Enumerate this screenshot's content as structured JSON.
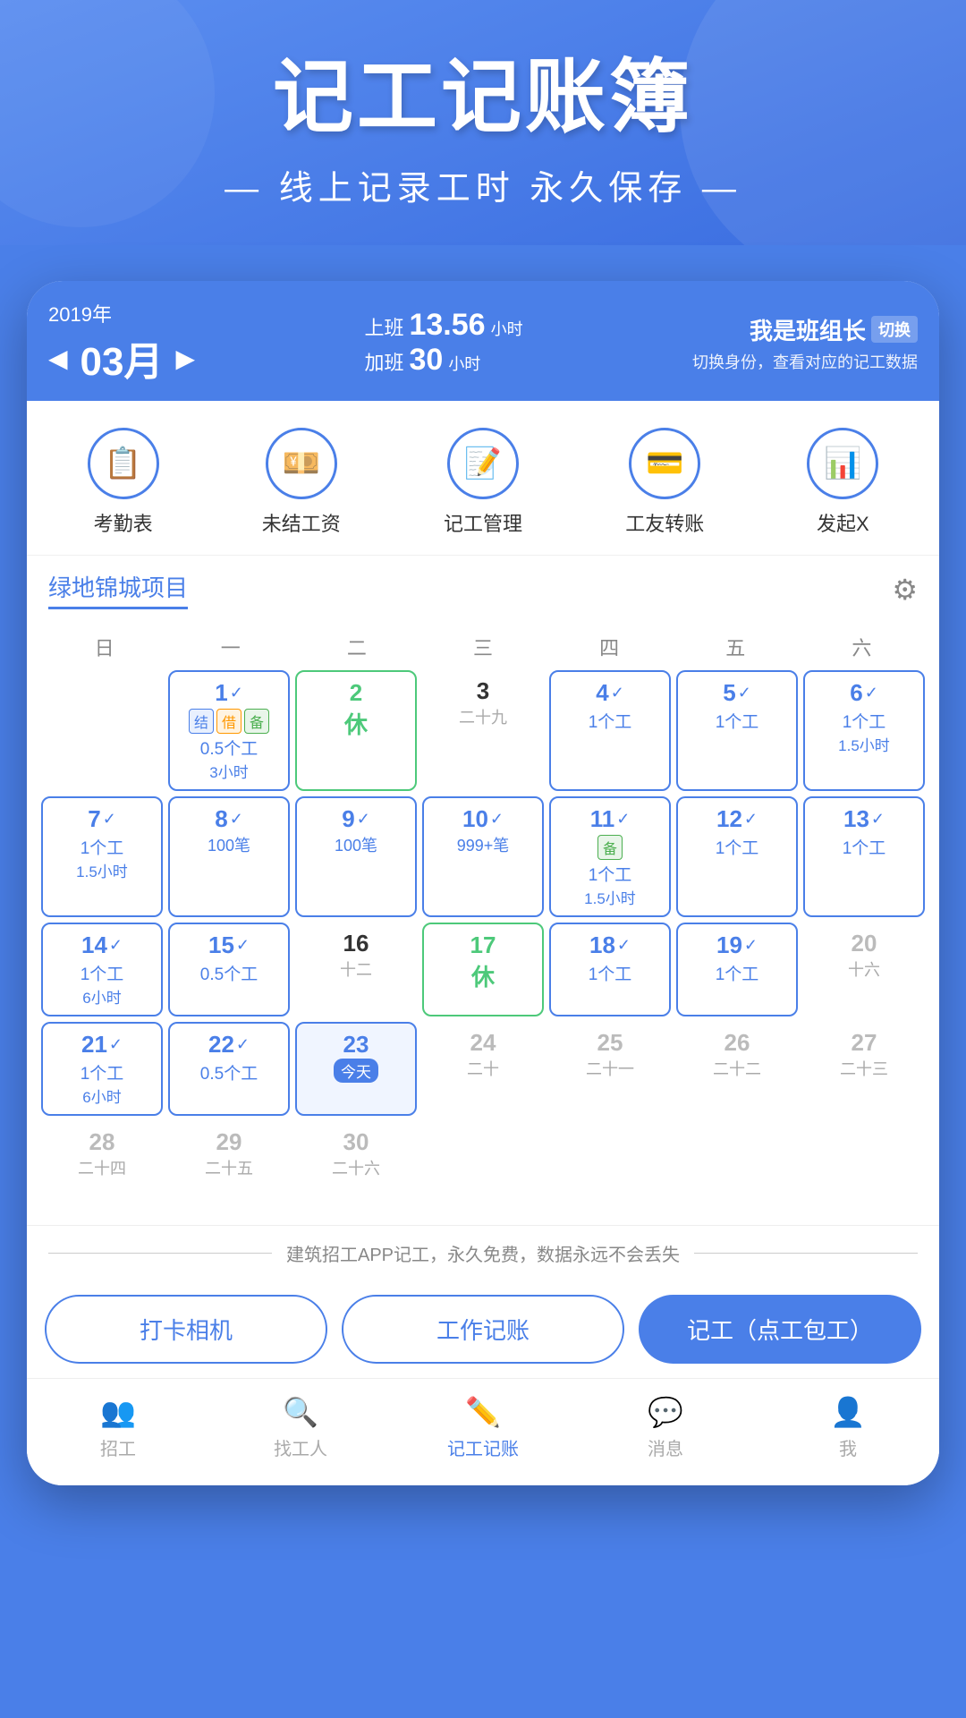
{
  "hero": {
    "title": "记工记账簿",
    "subtitle": "— 线上记录工时 永久保存 —"
  },
  "app_header": {
    "year": "2019年",
    "month": "03月",
    "prev_arrow": "◀",
    "next_arrow": "▶",
    "work_label": "上班",
    "work_hours": "13.56",
    "work_unit": "小时",
    "overtime_label": "加班",
    "overtime_hours": "30",
    "overtime_unit": "小时",
    "identity": "我是班组长",
    "switch_label": "切换",
    "identity_sub": "切换身份，查看对应的记工数据"
  },
  "functions": [
    {
      "icon": "📋",
      "label": "考勤表"
    },
    {
      "icon": "💴",
      "label": "未结工资"
    },
    {
      "icon": "📝",
      "label": "记工管理"
    },
    {
      "icon": "💳",
      "label": "工友转账"
    },
    {
      "icon": "📊",
      "label": "发起X"
    }
  ],
  "project": {
    "name": "绿地锦城项目",
    "settings_icon": "⚙"
  },
  "calendar": {
    "week_headers": [
      "日",
      "一",
      "二",
      "三",
      "四",
      "五",
      "六"
    ],
    "cells": [
      {
        "day": "",
        "type": "empty"
      },
      {
        "day": "1",
        "type": "data",
        "check": true,
        "tags": [
          "结",
          "借",
          "备"
        ],
        "work": "0.5个工",
        "hours": "3小时",
        "lunar": ""
      },
      {
        "day": "2",
        "type": "rest",
        "lunar": "",
        "rest": "休"
      },
      {
        "day": "3",
        "type": "plain",
        "lunar": "二十九"
      },
      {
        "day": "4",
        "type": "data",
        "check": true,
        "work": "1个工",
        "lunar": ""
      },
      {
        "day": "5",
        "type": "data",
        "check": true,
        "work": "1个工",
        "lunar": ""
      },
      {
        "day": "6",
        "type": "data",
        "check": true,
        "work": "1个工",
        "hours": "1.5小时",
        "lunar": ""
      },
      {
        "day": "7",
        "type": "data",
        "check": true,
        "work": "1个工",
        "hours": "1.5小时",
        "lunar": ""
      },
      {
        "day": "8",
        "type": "data",
        "check": true,
        "note": "100笔",
        "lunar": ""
      },
      {
        "day": "9",
        "type": "data",
        "check": true,
        "note": "100笔",
        "lunar": ""
      },
      {
        "day": "10",
        "type": "data",
        "check": true,
        "note": "999+笔",
        "lunar": ""
      },
      {
        "day": "11",
        "type": "data",
        "check": true,
        "tags": [
          "备"
        ],
        "work": "1个工",
        "hours": "1.5小时",
        "lunar": ""
      },
      {
        "day": "12",
        "type": "data",
        "check": true,
        "work": "1个工",
        "lunar": ""
      },
      {
        "day": "13",
        "type": "data",
        "check": true,
        "work": "1个工",
        "lunar": ""
      },
      {
        "day": "14",
        "type": "data",
        "check": true,
        "work": "1个工",
        "hours": "6小时",
        "lunar": ""
      },
      {
        "day": "15",
        "type": "data",
        "check": true,
        "work": "0.5个工",
        "lunar": ""
      },
      {
        "day": "16",
        "type": "plain",
        "lunar": "十二"
      },
      {
        "day": "17",
        "type": "rest",
        "lunar": "",
        "rest": "休"
      },
      {
        "day": "18",
        "type": "data",
        "check": true,
        "work": "1个工",
        "lunar": ""
      },
      {
        "day": "19",
        "type": "data",
        "check": true,
        "work": "1个工",
        "lunar": ""
      },
      {
        "day": "20",
        "type": "plain",
        "lunar": "十六"
      },
      {
        "day": "21",
        "type": "data",
        "check": true,
        "work": "1个工",
        "hours": "6小时",
        "lunar": ""
      },
      {
        "day": "22",
        "type": "data",
        "check": true,
        "work": "0.5个工",
        "lunar": ""
      },
      {
        "day": "23",
        "type": "today",
        "badge": "今天",
        "lunar": ""
      },
      {
        "day": "24",
        "type": "future",
        "lunar": "二十"
      },
      {
        "day": "25",
        "type": "future",
        "lunar": "二十一"
      },
      {
        "day": "26",
        "type": "future",
        "lunar": "二十二"
      },
      {
        "day": "27",
        "type": "future",
        "lunar": "二十三"
      },
      {
        "day": "28",
        "type": "plain",
        "lunar": "二十四"
      },
      {
        "day": "29",
        "type": "plain",
        "lunar": "二十五"
      },
      {
        "day": "30",
        "type": "plain",
        "lunar": "二十六"
      },
      {
        "day": "",
        "type": "empty"
      },
      {
        "day": "",
        "type": "empty"
      },
      {
        "day": "",
        "type": "empty"
      },
      {
        "day": "",
        "type": "empty"
      }
    ]
  },
  "ad": {
    "text": "建筑招工APP记工，永久免费，数据永远不会丢失"
  },
  "action_buttons": [
    {
      "label": "打卡相机",
      "primary": false
    },
    {
      "label": "工作记账",
      "primary": false
    },
    {
      "label": "记工（点工包工）",
      "primary": true
    }
  ],
  "bottom_nav": [
    {
      "icon": "👥",
      "label": "招工",
      "active": false
    },
    {
      "icon": "🔍",
      "label": "找工人",
      "active": false
    },
    {
      "icon": "✏️",
      "label": "记工记账",
      "active": true
    },
    {
      "icon": "💬",
      "label": "消息",
      "active": false
    },
    {
      "icon": "👤",
      "label": "我",
      "active": false
    }
  ]
}
